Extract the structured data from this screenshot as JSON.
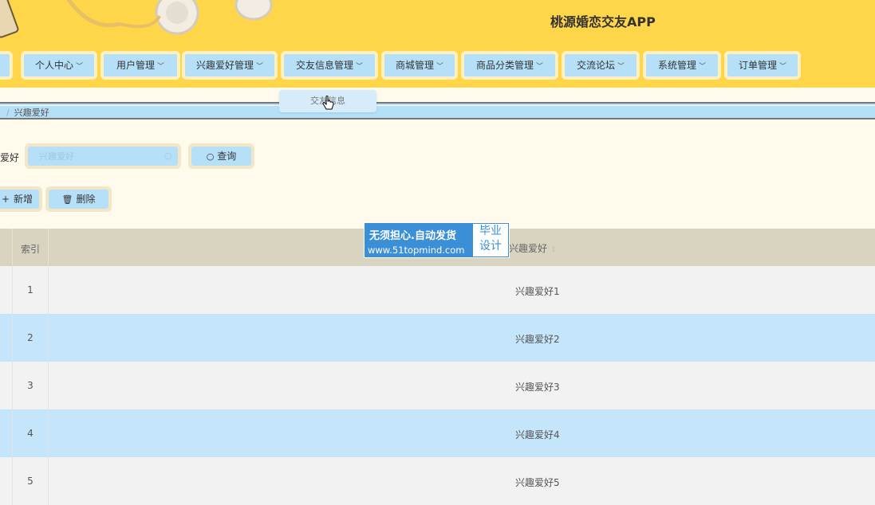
{
  "header": {
    "app_title": "桃源婚恋交友APP"
  },
  "nav": {
    "items": [
      {
        "label": "个人中心"
      },
      {
        "label": "用户管理"
      },
      {
        "label": "兴趣爱好管理"
      },
      {
        "label": "交友信息管理"
      },
      {
        "label": "商城管理"
      },
      {
        "label": "商品分类管理"
      },
      {
        "label": "交流论坛"
      },
      {
        "label": "系统管理"
      },
      {
        "label": "订单管理"
      }
    ],
    "dropdown_item": "交友信息"
  },
  "breadcrumb": {
    "current": "兴趣爱好"
  },
  "search": {
    "label": "爱好",
    "placeholder": "兴趣爱好",
    "query_button": "查询"
  },
  "actions": {
    "add_button": "新增",
    "delete_button": "删除"
  },
  "table": {
    "columns": {
      "index": "索引",
      "hobby": "兴趣爱好"
    },
    "rows": [
      {
        "index": "1",
        "hobby": "兴趣爱好1"
      },
      {
        "index": "2",
        "hobby": "兴趣爱好2"
      },
      {
        "index": "3",
        "hobby": "兴趣爱好3"
      },
      {
        "index": "4",
        "hobby": "兴趣爱好4"
      },
      {
        "index": "5",
        "hobby": "兴趣爱好5"
      }
    ]
  },
  "watermark": {
    "line1": "无须担心.自动发货",
    "line2": "www.51topmind.com",
    "badge_line1": "毕业",
    "badge_line2": "设计"
  },
  "colors": {
    "header": "#ffd64a",
    "nav_item": "#b6e0f8",
    "row_alt": "#c5e6fa",
    "page_bg": "#fffbec"
  }
}
